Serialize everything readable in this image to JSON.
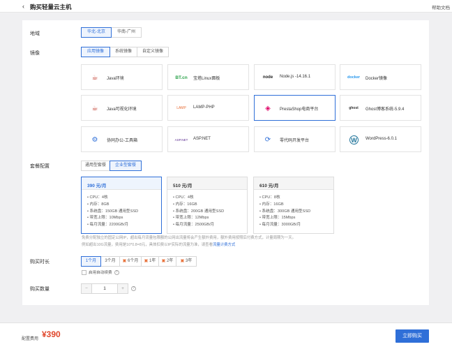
{
  "header": {
    "back_icon": "‹",
    "title": "购买轻量云主机",
    "help_link": "帮助文档"
  },
  "region": {
    "label": "地域",
    "options": [
      "华北-北京",
      "华南-广州"
    ],
    "selected": 0
  },
  "image": {
    "label": "镜像",
    "tabs": [
      "应用镜像",
      "系统镜像",
      "自定义镜像"
    ],
    "selected_tab": 0,
    "cards": [
      {
        "name": "Java环境",
        "icon": "java-icon",
        "logo": "☕"
      },
      {
        "name": "宝塔Linux面板",
        "icon": "bt-panel-icon",
        "logo": "BT.cn"
      },
      {
        "name": "Node.js -14.16.1",
        "icon": "nodejs-icon",
        "logo": "node"
      },
      {
        "name": "Docker镜像",
        "icon": "docker-icon",
        "logo": "docker"
      },
      {
        "name": "Java可视化环境",
        "icon": "java-icon",
        "logo": "☕"
      },
      {
        "name": "LAMP-PHP",
        "icon": "lamp-icon",
        "logo": "LAMP"
      },
      {
        "name": "PrestaShop电商平台",
        "icon": "prestashop-icon",
        "logo": "◈"
      },
      {
        "name": "Ghost博客系统-5.9.4",
        "icon": "ghost-icon",
        "logo": "ghost"
      },
      {
        "name": "协同办公-工具箱",
        "icon": "office-tools-icon",
        "logo": "⚙"
      },
      {
        "name": "ASP.NET",
        "icon": "aspnet-icon",
        "logo": "ASP.NET"
      },
      {
        "name": "零代码开发平台",
        "icon": "lowcode-icon",
        "logo": "⟳"
      },
      {
        "name": "WordPress-6.0.1",
        "icon": "wordpress-icon",
        "logo": "W"
      }
    ],
    "selected_card": 6
  },
  "package": {
    "label": "套餐配置",
    "tabs": [
      "通用型套餐",
      "企业型套餐"
    ],
    "selected_tab": 1,
    "plans": [
      {
        "price": "390 元/月",
        "specs": [
          "CPU：4核",
          "内存：8GB",
          "系统盘：150GB 通用型SSD",
          "带宽上限：10Mbps",
          "每月流量：2200GB/月"
        ]
      },
      {
        "price": "510 元/月",
        "specs": [
          "CPU：4核",
          "内存：16GB",
          "系统盘：200GB 通用型SSD",
          "带宽上限：12Mbps",
          "每月流量：2500GB/月"
        ]
      },
      {
        "price": "610 元/月",
        "specs": [
          "CPU：8核",
          "内存：16GB",
          "系统盘：300GB 通用型SSD",
          "带宽上限：15Mbps",
          "每月流量：3000GB/月"
        ]
      }
    ],
    "selected_plan": 0,
    "note_line1": "免费分配独立的固定公网IP，超出每月流量包限额的公网出流量将会产生额外费用，额外费用按照后付费方式，计量周期为一天。",
    "note_line2": "例如超出10G流量，费用是10*0.8=8元，具体扣费以IP实际的流量为准，请查看",
    "note_link": "流量计费方式"
  },
  "duration": {
    "label": "购买时长",
    "options": [
      "1个月",
      "3个月",
      "6个月",
      "1年",
      "2年",
      "3年"
    ],
    "gift_icons": [
      false,
      false,
      true,
      true,
      true,
      true
    ],
    "selected": 0,
    "auto_renew_label": "启用自动续费",
    "help_icon": "?"
  },
  "quantity": {
    "label": "购买数量",
    "minus": "−",
    "value": "1",
    "plus": "+",
    "help_icon": "?"
  },
  "footer": {
    "fee_label": "配置费用",
    "fee": "¥390",
    "buy_button": "立即购买"
  },
  "colors": {
    "accent": "#2f6fd8",
    "price": "#e0472c"
  }
}
